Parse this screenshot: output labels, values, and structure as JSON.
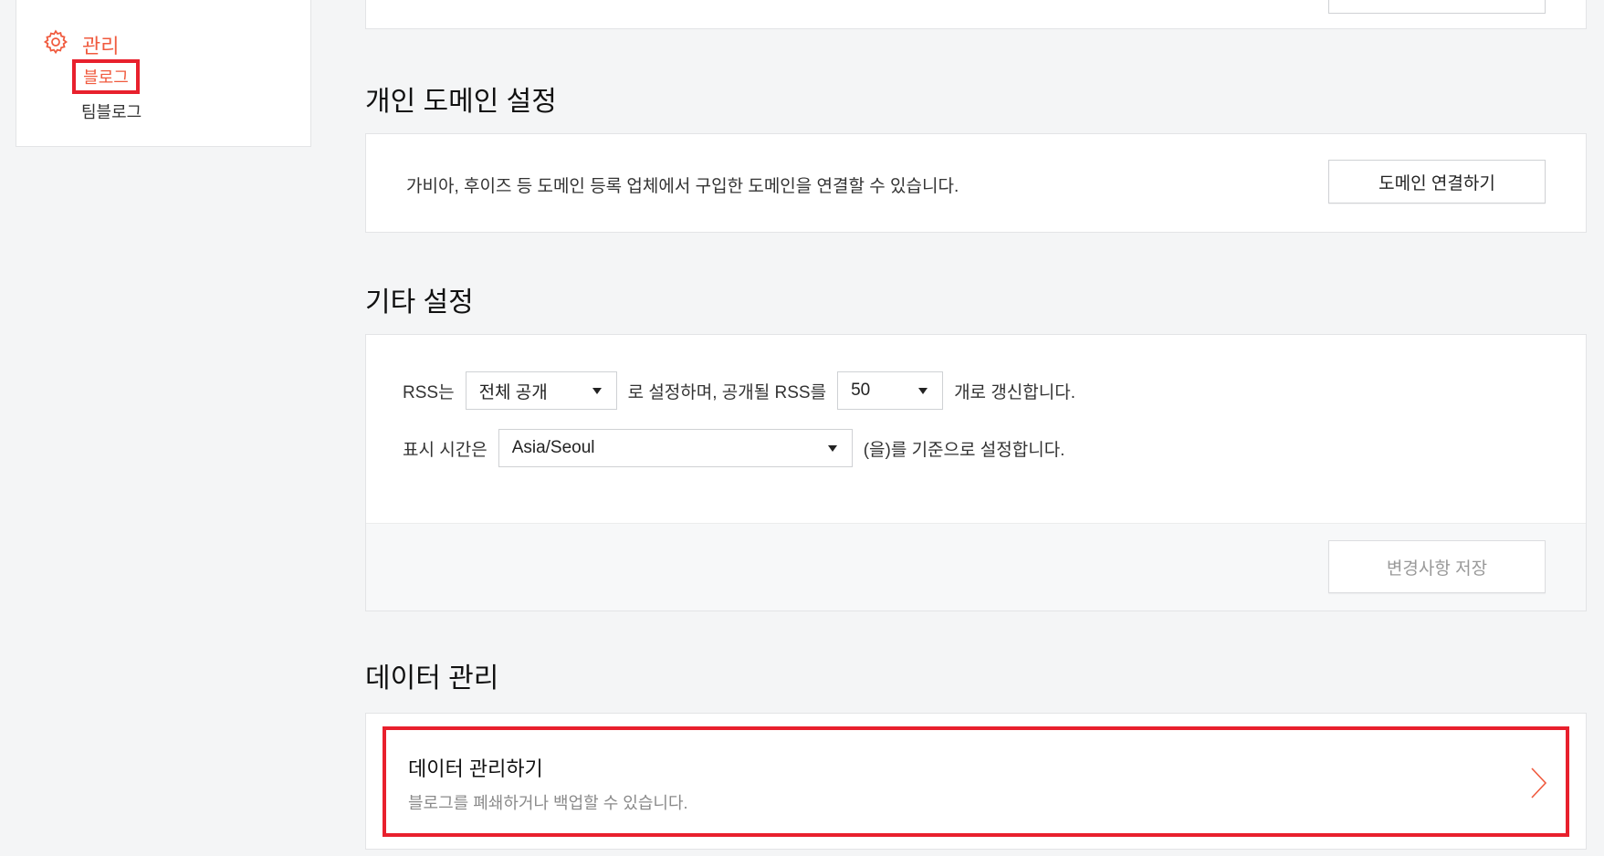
{
  "sidebar": {
    "section_label": "관리",
    "items": [
      {
        "label": "블로그",
        "active": true
      },
      {
        "label": "팀블로그",
        "active": false
      }
    ],
    "accent_color": "#f05a3e",
    "highlight_color": "#e8202d"
  },
  "domain_section": {
    "title": "개인 도메인 설정",
    "description": "가비아, 후이즈 등 도메인 등록 업체에서 구입한 도메인을 연결할 수 있습니다.",
    "button_label": "도메인 연결하기"
  },
  "other_section": {
    "title": "기타 설정",
    "rss_prefix": "RSS는",
    "rss_select_value": "전체 공개",
    "rss_middle": "로 설정하며, 공개될 RSS를",
    "rss_count_value": "50",
    "rss_suffix": "개로 갱신합니다.",
    "time_prefix": "표시 시간은",
    "time_select_value": "Asia/Seoul",
    "time_suffix": "(을)를 기준으로 설정합니다.",
    "save_button_label": "변경사항 저장"
  },
  "data_section": {
    "title": "데이터 관리",
    "link_title": "데이터 관리하기",
    "link_description": "블로그를 폐쇄하거나 백업할 수 있습니다."
  }
}
